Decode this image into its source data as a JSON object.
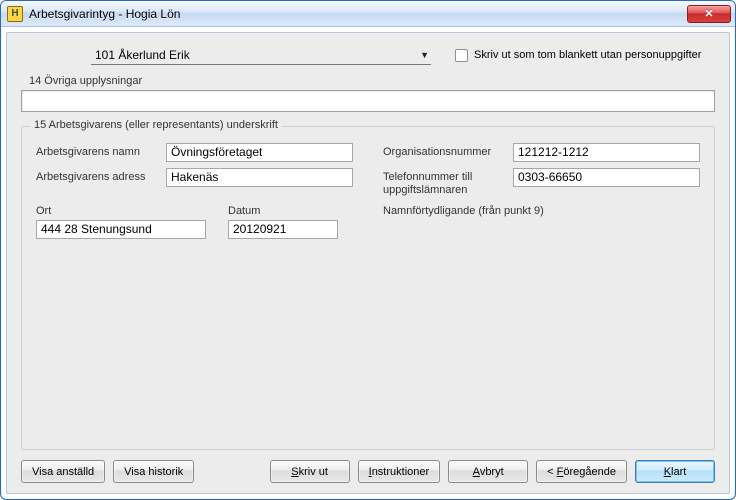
{
  "window": {
    "title": "Arbetsgivarintyg - Hogia Lön",
    "app_icon_letter": "H"
  },
  "top": {
    "employee": "101  Åkerlund Erik",
    "blank_checkbox_label": "Skriv ut som tom blankett utan personuppgifter"
  },
  "section14": {
    "label": "14 Övriga upplysningar",
    "value": ""
  },
  "section15": {
    "label": "15 Arbetsgivarens (eller representants) underskrift",
    "left": {
      "employer_name_label": "Arbetsgivarens namn",
      "employer_name": "Övningsföretaget",
      "employer_address_label": "Arbetsgivarens adress",
      "employer_address": "Hakenäs",
      "ort_label": "Ort",
      "ort": "444 28 Stenungsund",
      "datum_label": "Datum",
      "datum": "20120921"
    },
    "right": {
      "orgnr_label": "Organisationsnummer",
      "orgnr": "121212-1212",
      "phone_label": "Telefonnummer till uppgiftslämnaren",
      "phone": "0303-66650",
      "signature_note": "Namnförtydligande (från punkt 9)"
    }
  },
  "buttons": {
    "visa_anstalld": "Visa anställd",
    "visa_historik": "Visa historik",
    "skriv_ut": "Skriv ut",
    "instruktioner": "Instruktioner",
    "avbryt": "Avbryt",
    "foregaende": "Föregående",
    "klart": "Klart"
  }
}
